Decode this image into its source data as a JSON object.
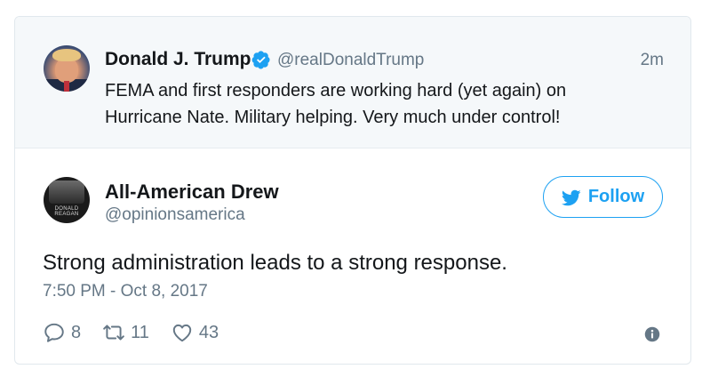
{
  "parent_tweet": {
    "author_name": "Donald J. Trump",
    "handle": "@realDonaldTrump",
    "time_ago": "2m",
    "text": "FEMA and first responders are working hard (yet again) on Hurricane Nate. Military helping. Very much under control!",
    "verified_icon": "verified-badge-icon"
  },
  "tweet": {
    "author_name": "All-American Drew",
    "handle": "@opinionsamerica",
    "avatar_caption": "DONALD REAGAN",
    "follow_label": "Follow",
    "text": "Strong administration leads to a strong response.",
    "timestamp": "7:50 PM - Oct 8, 2017",
    "stats": {
      "replies": "8",
      "retweets": "11",
      "likes": "43"
    }
  },
  "colors": {
    "brand_blue": "#1da1f2",
    "muted_text": "#657786",
    "parent_background": "#f5f8fa"
  }
}
